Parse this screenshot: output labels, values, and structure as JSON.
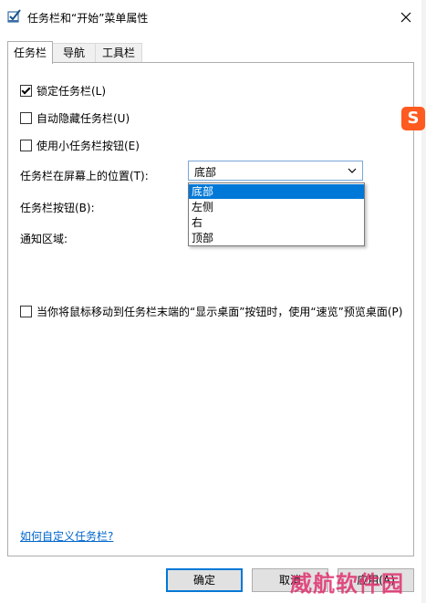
{
  "window": {
    "title": "任务栏和“开始”菜单属性",
    "icon": "taskbar-checklist-icon",
    "close_icon": "close-icon"
  },
  "tabs": [
    {
      "label": "任务栏",
      "active": true
    },
    {
      "label": "导航",
      "active": false
    },
    {
      "label": "工具栏",
      "active": false
    }
  ],
  "options": {
    "lock_taskbar": {
      "label": "锁定任务栏(L)",
      "checked": true
    },
    "auto_hide": {
      "label": "自动隐藏任务栏(U)",
      "checked": false
    },
    "small_buttons": {
      "label": "使用小任务栏按钮(E)",
      "checked": false
    },
    "peek": {
      "label": "当你将鼠标移动到任务栏末端的“显示桌面”按钮时，使用“速览”预览桌面(P)",
      "checked": false
    }
  },
  "position": {
    "label": "任务栏在屏幕上的位置(T):",
    "selected": "底部",
    "items": [
      "底部",
      "左侧",
      "右",
      "顶部"
    ]
  },
  "buttons_label": "任务栏按钮(B):",
  "notification_label": "通知区域:",
  "help_link": "如何自定义任务栏?",
  "footer": {
    "ok": "确定",
    "cancel": "取消",
    "apply": "应用(A)"
  },
  "overlay": {
    "sogou_badge": "S",
    "watermark": "威航软件园"
  },
  "colors": {
    "accent": "#0078d7",
    "link": "#0066cc",
    "sogou": "#ff5a1f",
    "watermark": "#e0306d"
  }
}
